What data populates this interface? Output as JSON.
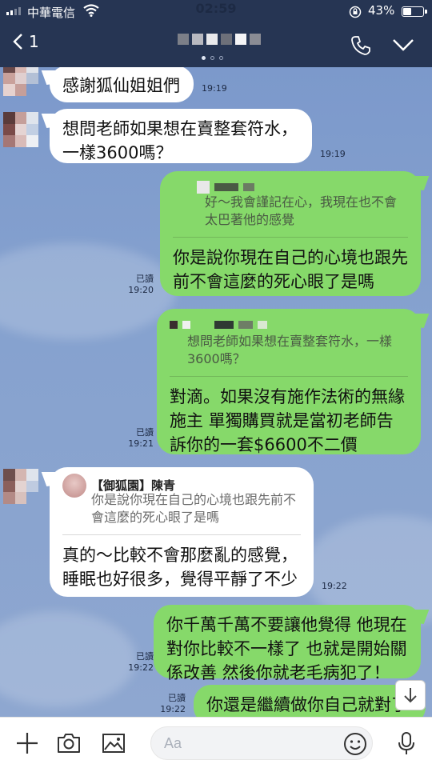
{
  "status_bar": {
    "carrier": "中華電信",
    "time": "02:59",
    "battery_pct": "43%"
  },
  "header": {
    "back_count": "1",
    "call_icon": "phone-icon",
    "menu_icon": "chevron-down-icon"
  },
  "messages": [
    {
      "id": "m1",
      "side": "in",
      "text": "感謝狐仙姐姐們",
      "time": "19:19"
    },
    {
      "id": "m2",
      "side": "in",
      "text": "想問老師如果想在賣整套符水，一樣3600嗎？",
      "time": "19:19"
    },
    {
      "id": "m3",
      "side": "out",
      "quote": "好～我會謹記在心，我現在也不會太巴著他的感覺",
      "text": "你是說你現在自己的心境也跟先前不會這麼的死心眼了是嗎",
      "read": "已讀",
      "time": "19:20"
    },
    {
      "id": "m4",
      "side": "out",
      "quote": "想問老師如果想在賣整套符水，一樣3600嗎？",
      "text": "對滴。如果沒有施作法術的無緣施主 單獨購買就是當初老師告訴你的一套$6600不二價",
      "read": "已讀",
      "time": "19:21"
    },
    {
      "id": "m5",
      "side": "in",
      "quote_author": "【御狐園】陳青",
      "quote": "你是說你現在自己的心境也跟先前不會這麼的死心眼了是嗎",
      "text": "真的～比較不會那麼亂的感覺，睡眠也好很多，覺得平靜了不少",
      "time": "19:22"
    },
    {
      "id": "m6",
      "side": "out",
      "text": "你千萬千萬不要讓他覺得 他現在對你比較不一樣了 也就是開始關係改善 然後你就老毛病犯了！",
      "read": "已讀",
      "time": "19:22"
    },
    {
      "id": "m7",
      "side": "out",
      "text": "你還是繼續做你自己就對了",
      "read": "已讀",
      "time": "19:22"
    }
  ],
  "input": {
    "placeholder": "Aa"
  },
  "colors": {
    "header_bg": "#263553",
    "bubble_out": "#86d96a",
    "bubble_in": "#ffffff",
    "chat_bg": "#7f9bcc"
  },
  "icons": [
    "plus-icon",
    "camera-icon",
    "image-icon",
    "emoji-icon",
    "microphone-icon",
    "scroll-down-icon"
  ]
}
